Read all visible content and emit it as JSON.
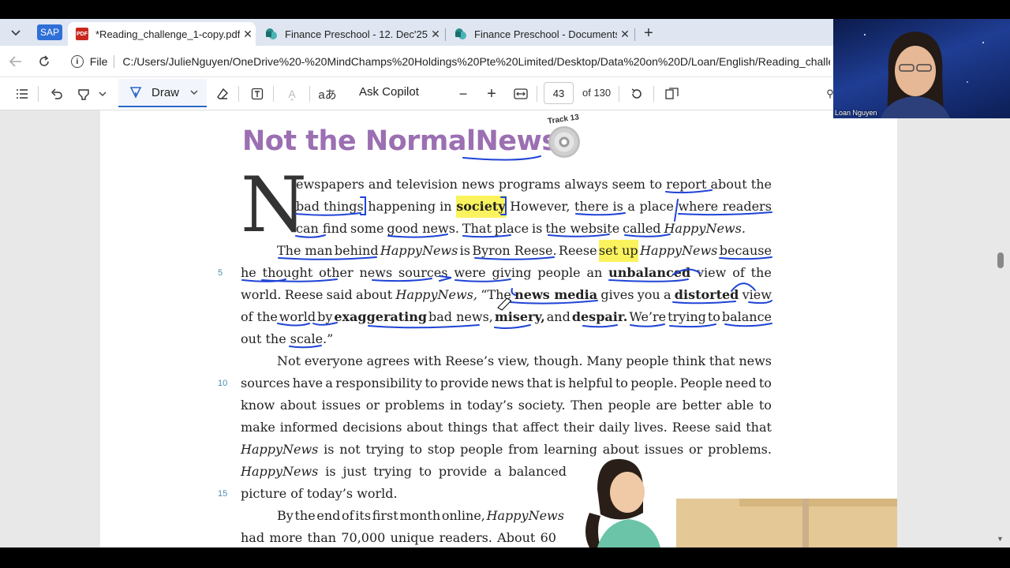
{
  "tabs": [
    {
      "title": "*Reading_challenge_1-copy.pdf",
      "active": true,
      "icon": "pdf-icon"
    },
    {
      "title": "Finance Preschool - 12. Dec'25 - /",
      "active": false,
      "icon": "sharepoint-icon"
    },
    {
      "title": "Finance Preschool - Documents -",
      "active": false,
      "icon": "sharepoint-icon"
    }
  ],
  "sap_label": "SAP",
  "address": {
    "file_label": "File",
    "url": "C:/Users/JulieNguyen/OneDrive%20-%20MindChamps%20Holdings%20Pte%20Limited/Desktop/Data%20on%20D/Loan/English/Reading_challen..."
  },
  "toolbar": {
    "draw_label": "Draw",
    "copilot_label": "Ask Copilot",
    "page_number": "43",
    "page_total": "of 130"
  },
  "document": {
    "title_main": "Not the Normal ",
    "title_news": "News",
    "track_label": "Track 13",
    "dropcap": "N",
    "line_numbers": [
      "5",
      "10",
      "15"
    ],
    "p1_l1": [
      "ewspapers",
      "and",
      "television",
      "news",
      "programs",
      "always",
      "seem",
      "to",
      "report",
      "about",
      "the"
    ],
    "p1_l2": [
      "bad things",
      "happening in",
      "society",
      "However,",
      "there is",
      "a",
      "place",
      "where",
      "readers"
    ],
    "p1_l3": [
      "can find",
      "some",
      "good news.",
      "That",
      "place",
      "is",
      "the website",
      "called",
      "HappyNews."
    ],
    "p2_l1": [
      "The man",
      "behind",
      "HappyNews",
      "is",
      "Byron Reese.",
      "Reese",
      "set up",
      "HappyNews",
      "because"
    ],
    "p2_l2": [
      "he",
      "thought",
      "other",
      "news",
      "sources",
      "were",
      "giving",
      "people",
      "an",
      "unbalanced",
      "view",
      "of",
      "the"
    ],
    "p2_l3": [
      "world.",
      "Reese",
      "said",
      "about",
      "HappyNews,",
      "“The",
      "news media",
      "gives",
      "you",
      "a",
      "distorted",
      "view"
    ],
    "p2_l4": [
      "of the",
      "world",
      "by",
      "exaggerating",
      "bad news,",
      "misery,",
      "and",
      "despair.",
      "We’re",
      "trying",
      "to",
      "balance"
    ],
    "p2_l5": "out the scale.”",
    "p3_l1": [
      "Not",
      "everyone",
      "agrees",
      "with",
      "Reese’s",
      "view,",
      "though.",
      "Many",
      "people",
      "think",
      "that",
      "news"
    ],
    "p3_l2": [
      "sources",
      "have",
      "a",
      "responsibility",
      "to",
      "provide",
      "news",
      "that",
      "is",
      "helpful",
      "to",
      "people.",
      "People",
      "need",
      "to"
    ],
    "p3_l3": [
      "know",
      "about",
      "issues",
      "or",
      "problems",
      "in",
      "today’s",
      "society.",
      "Then",
      "people",
      "are",
      "better",
      "able",
      "to"
    ],
    "p3_l4": [
      "make",
      "informed",
      "decisions",
      "about",
      "things",
      "that",
      "affect",
      "their",
      "daily",
      "lives.",
      "Reese",
      "said",
      "that"
    ],
    "p3_l5": [
      "HappyNews",
      "is",
      "not",
      "trying",
      "to",
      "stop",
      "people",
      "from",
      "learning",
      "about",
      "issues",
      "or",
      "problems."
    ],
    "p3_l6": [
      "HappyNews",
      "is",
      "just",
      "trying",
      "to",
      "provide",
      "a",
      "balanced"
    ],
    "p3_l7": "picture of today’s world.",
    "p4_l1": [
      "By",
      "the",
      "end",
      "of",
      "its",
      "first",
      "month",
      "online,",
      "HappyNews"
    ],
    "p4_l2": [
      "had",
      "more",
      "than",
      "70,000",
      "unique",
      "readers.",
      "About",
      "60"
    ]
  },
  "webcam": {
    "name": "Loan Nguyen"
  },
  "colors": {
    "accent": "#2b67c8",
    "title": "#9b6fb2",
    "highlight": "#fbf35d",
    "ink": "#1f44d6"
  }
}
